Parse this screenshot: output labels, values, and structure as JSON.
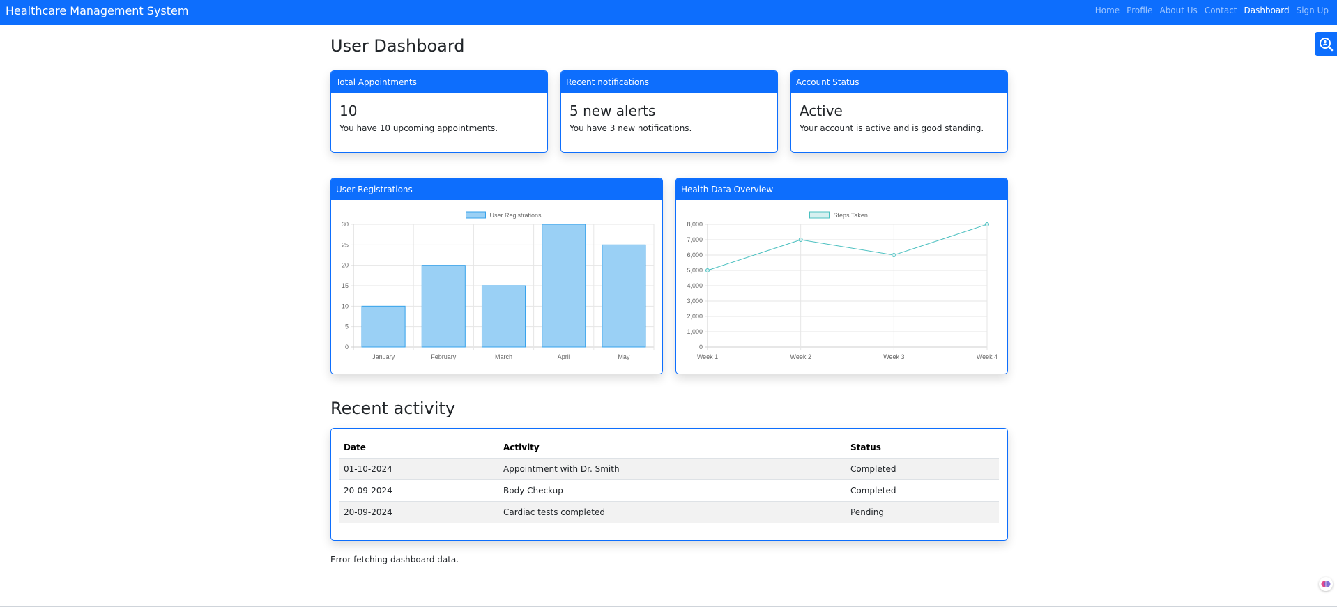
{
  "navbar": {
    "brand": "Healthcare Management System",
    "links": [
      {
        "label": "Home",
        "active": false
      },
      {
        "label": "Profile",
        "active": false
      },
      {
        "label": "About Us",
        "active": false
      },
      {
        "label": "Contact",
        "active": false
      },
      {
        "label": "Dashboard",
        "active": true
      },
      {
        "label": "Sign Up",
        "active": false
      }
    ]
  },
  "page_title": "User Dashboard",
  "cards": [
    {
      "header": "Total Appointments",
      "value": "10",
      "text": "You have 10 upcoming appointments."
    },
    {
      "header": "Recent notifications",
      "value": "5 new alerts",
      "text": "You have 3 new notifications."
    },
    {
      "header": "Account Status",
      "value": "Active",
      "text": "Your account is active and is good standing."
    }
  ],
  "charts": {
    "registrations_header": "User Registrations",
    "health_header": "Health Data Overview"
  },
  "chart_data": [
    {
      "type": "bar",
      "title": "",
      "categories": [
        "January",
        "February",
        "March",
        "April",
        "May"
      ],
      "series": [
        {
          "name": "User Registrations",
          "values": [
            10,
            20,
            15,
            30,
            25
          ]
        }
      ],
      "ylim": [
        0,
        30
      ],
      "yticks": [
        "0",
        "5",
        "10",
        "15",
        "20",
        "25",
        "30"
      ],
      "grid": true,
      "legend": "top-center",
      "color": "#9ad0f5",
      "border_color": "#36a2eb"
    },
    {
      "type": "line",
      "title": "",
      "categories": [
        "Week 1",
        "Week 2",
        "Week 3",
        "Week 4"
      ],
      "series": [
        {
          "name": "Steps Taken",
          "values": [
            5000,
            7000,
            6000,
            8000
          ]
        }
      ],
      "ylim": [
        0,
        8000
      ],
      "yticks": [
        "0",
        "1,000",
        "2,000",
        "3,000",
        "4,000",
        "5,000",
        "6,000",
        "7,000",
        "8,000"
      ],
      "grid": true,
      "legend": "top-center",
      "color": "#4bc0c0"
    }
  ],
  "recent_activity": {
    "title": "Recent activity",
    "columns": [
      "Date",
      "Activity",
      "Status"
    ],
    "rows": [
      [
        "01-10-2024",
        "Appointment with Dr. Smith",
        "Completed"
      ],
      [
        "20-09-2024",
        "Body Checkup",
        "Completed"
      ],
      [
        "20-09-2024",
        "Cardiac tests completed",
        "Pending"
      ]
    ]
  },
  "error_message": "Error fetching dashboard data.",
  "icons": {
    "accessibility": "accessibility-search-icon",
    "floating": "brain-widget-icon"
  },
  "colors": {
    "primary": "#0d6efd"
  }
}
